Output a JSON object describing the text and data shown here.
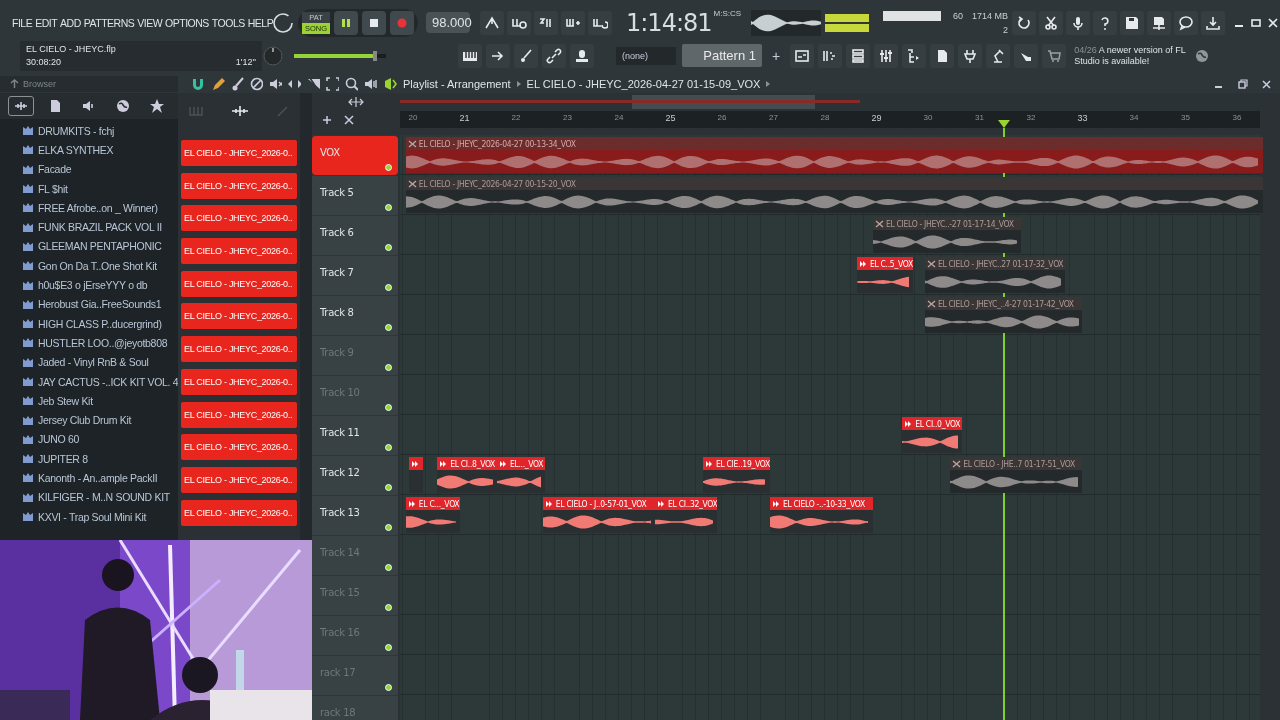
{
  "menu": [
    "FILE",
    "EDIT",
    "ADD",
    "PATTERNS",
    "VIEW",
    "OPTIONS",
    "TOOLS",
    "HELP"
  ],
  "transport": {
    "modes": [
      {
        "label": "PAT",
        "selected": false
      },
      {
        "label": "SONG",
        "selected": true
      }
    ],
    "playing": true,
    "tempo": "98.000"
  },
  "time": {
    "value": "1:14:81",
    "unit": "M:S:CS"
  },
  "performance": {
    "cpu": "60",
    "memory": "1714 MB",
    "polyphony": "2"
  },
  "project": {
    "file": "EL CIELO - JHEYC.flp",
    "time": "30:08:20",
    "length": "1'12''"
  },
  "master_volume": {
    "level": 0.88
  },
  "pattern": {
    "channel_filter": "(none)",
    "name": "Pattern 1",
    "add": "+"
  },
  "news": {
    "date": "04/26",
    "message": "A newer version of FL Studio is available!"
  },
  "browser": {
    "title": "Browser",
    "items": [
      "DRUMKITS - fchj",
      "ELKA SYNTHEX",
      "Facade",
      "FL $hit",
      "FREE Afrobe..on _ Winner)",
      "FUNK BRAZIL PACK VOL II",
      "GLEEMAN PENTAPHONIC",
      "Gon On Da T..One Shot Kit",
      "h0u$E3 o jErseYYY o db",
      "Herobust Gia..FreeSounds1",
      "HIGH CLASS P..ducergrind)",
      "HUSTLER LOO..@jeyotb808",
      "Jaded - Vinyl RnB & Soul",
      "JAY CACTUS -..ICK KIT VOL. 4",
      "Jeb Stew Kit",
      "Jersey Club Drum Kit",
      "JUNO 60",
      "JUPITER 8",
      "Kanonth - An..ample PackII",
      "KILFIGER - M..N SOUND KIT",
      "KXVI - Trap Soul Mini Kit"
    ]
  },
  "playlist": {
    "title": "Playlist - Arrangement",
    "path": "EL CIELO - JHEYC_2026-04-27 01-15-09_VOX",
    "ruler": [
      "20",
      "21",
      "22",
      "23",
      "24",
      "25",
      "26",
      "27",
      "28",
      "29",
      "30",
      "31",
      "32",
      "33",
      "34",
      "35",
      "36"
    ],
    "patterns": [
      "EL CIELO - JHEYC_2026-0..",
      "EL CIELO - JHEYC_2026-0..",
      "EL CIELO - JHEYC_2026-0..",
      "EL CIELO - JHEYC_2026-0..",
      "EL CIELO - JHEYC_2026-0..",
      "EL CIELO - JHEYC_2026-0..",
      "EL CIELO - JHEYC_2026-0..",
      "EL CIELO - JHEYC_2026-0..",
      "EL CIELO - JHEYC_2026-0..",
      "EL CIELO - JHEYC_2026-0..",
      "EL CIELO - JHEYC_2026-0..",
      "EL CIELO - JHEYC_2026-0.."
    ],
    "tracks": [
      {
        "name": "VOX",
        "selected": true,
        "empty": false,
        "clips": [
          {
            "label": "EL CIELO - JHEYC_2026-04-27 00-13-34_VOX",
            "selected": false
          }
        ]
      },
      {
        "name": "Track 5",
        "selected": false,
        "empty": false,
        "clips": [
          {
            "label": "EL CIELO - JHEYC_2026-04-27 00-15-20_VOX",
            "selected": false
          }
        ]
      },
      {
        "name": "Track 6",
        "selected": false,
        "empty": false,
        "clips": [
          {
            "label": "EL CIELO - JHEYC..-27 01-17-14_VOX",
            "selected": false
          }
        ]
      },
      {
        "name": "Track 7",
        "selected": false,
        "empty": false,
        "clips": [
          {
            "label": "EL C..5_VOX",
            "selected": true
          },
          {
            "label": "EL CIELO - JHEYC..27 01-17-32_VOX",
            "selected": false
          }
        ]
      },
      {
        "name": "Track 8",
        "selected": false,
        "empty": false,
        "clips": [
          {
            "label": "EL CIELO - JHEYC_..4-27 01-17-42_VOX",
            "selected": false
          }
        ]
      },
      {
        "name": "Track 9",
        "selected": false,
        "empty": true
      },
      {
        "name": "Track 10",
        "selected": false,
        "empty": true
      },
      {
        "name": "Track 11",
        "selected": false,
        "empty": false,
        "clips": [
          {
            "label": "EL CI..0_VOX",
            "selected": true
          }
        ]
      },
      {
        "name": "Track 12",
        "selected": false,
        "empty": false,
        "clips": [
          {
            "selected": true
          },
          {
            "label": "EL CI..8_VOX",
            "selected": true
          },
          {
            "label": "EL..._VOX",
            "selected": true
          },
          {
            "label": "EL CIE..19_VOX",
            "selected": true
          },
          {
            "label": "EL CIELO - JHE..7 01-17-51_VOX",
            "selected": false
          }
        ]
      },
      {
        "name": "Track 13",
        "selected": false,
        "empty": false,
        "clips": [
          {
            "label": "EL C..._VOX",
            "selected": true
          },
          {
            "label": "EL CIELO - J..0-57-01_VOX",
            "selected": true
          },
          {
            "label": "EL CI..32_VOX",
            "selected": true
          },
          {
            "label": "EL CIELO -..-10-33_VOX",
            "selected": true
          }
        ]
      },
      {
        "name": "Track 14",
        "selected": false,
        "empty": true
      },
      {
        "name": "Track 15",
        "selected": false,
        "empty": true
      },
      {
        "name": "Track 16",
        "selected": false,
        "empty": true
      },
      {
        "name": "rack 17",
        "selected": false,
        "empty": true
      },
      {
        "name": "rack 18",
        "selected": false,
        "empty": true
      }
    ]
  }
}
